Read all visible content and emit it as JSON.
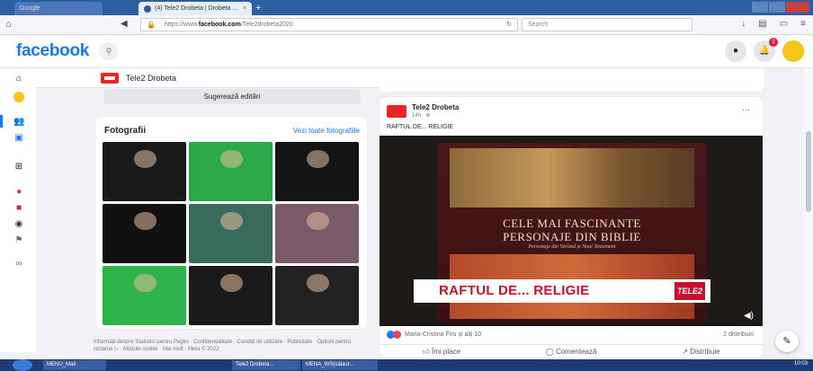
{
  "browser": {
    "tabs": [
      {
        "label": "Google"
      },
      {
        "label": "(4) Tele2 Drobeta | Drobeta ...",
        "close": "×"
      }
    ],
    "new_tab": "+",
    "url_prefix": "https://www.",
    "url_domain": "facebook.com",
    "url_path": "/Tele2drobeta2020",
    "search_placeholder": "Search"
  },
  "header": {
    "logo": "facebook",
    "notification_count": "2"
  },
  "page": {
    "name": "Tele2 Drobeta",
    "more_label": "···"
  },
  "left": {
    "suggest_button": "Sugerează editări",
    "photos_title": "Fotografii",
    "see_all": "Vezi toate fotografiile",
    "photo_colors": [
      "#1a1a1a",
      "#2aa84a",
      "#141414",
      "#111111",
      "#3a6a5a",
      "#7a5a6a",
      "#2fb34a",
      "#1a1a1a",
      "#222222"
    ],
    "footer": "Informații despre Statistici pentru Pagini · Confidențialitate · Condiții de utilizare · Publicitate · Opțiuni pentru reclame ▷ · Module cookie · Mai mult · Meta © 2022"
  },
  "post": {
    "author": "Tele2 Drobeta",
    "time": "14h · ⊕",
    "text": "RAFTUL DE... RELIGIE",
    "book_title_1": "CELE MAI FASCINANTE",
    "book_title_2": "PERSONAJE DIN BIBLIE",
    "book_subtitle": "Personaje din Vechiul și Noul Testament",
    "lower_third": "RAFTUL DE... RELIGIE",
    "tv_logo": "TELE2",
    "reactions": "Maria-Cristina Firu și alți 10",
    "shares": "2 distribuiri",
    "like": "Îmi place",
    "comment": "Comentează",
    "share": "Distribuie"
  },
  "taskbar": {
    "items": [
      "MENU_Mail",
      "Tele2 Drobeta...",
      "MENA_WS(cálaur..."
    ],
    "clock": "10:03"
  }
}
